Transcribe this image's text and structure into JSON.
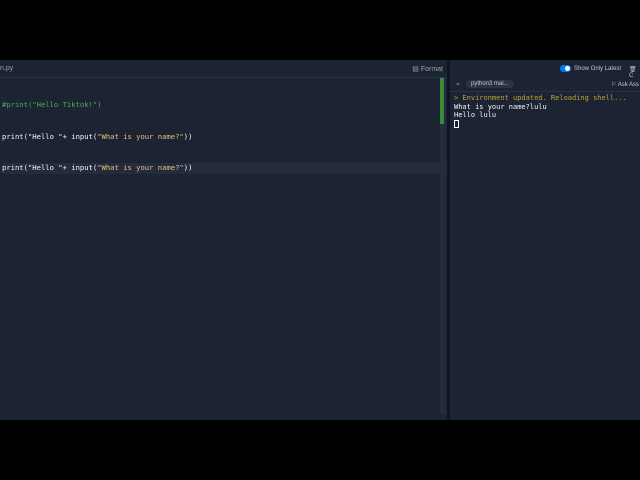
{
  "editor": {
    "filename": "n.py",
    "format_label": "Format",
    "lines": [
      {
        "comment": "#print(\"Hello Tiktok!\")"
      },
      {
        "pre": "print(\"Hello \"+ input(",
        "str": "\"What is your name?\"",
        "post": "))"
      },
      {
        "pre": "print(\"Hello \"+ input(",
        "str": "\"What is your name?\"",
        "post": "))"
      }
    ]
  },
  "console": {
    "show_only_latest_label": "Show Only Latest",
    "show_only_latest": true,
    "clear_label": "C",
    "tab_label": "python3 mai...",
    "ask_label": "Ask Ass",
    "output": [
      "> Environment updated. Reloading shell...",
      "What is your name?lulu",
      "Hello lulu"
    ]
  }
}
